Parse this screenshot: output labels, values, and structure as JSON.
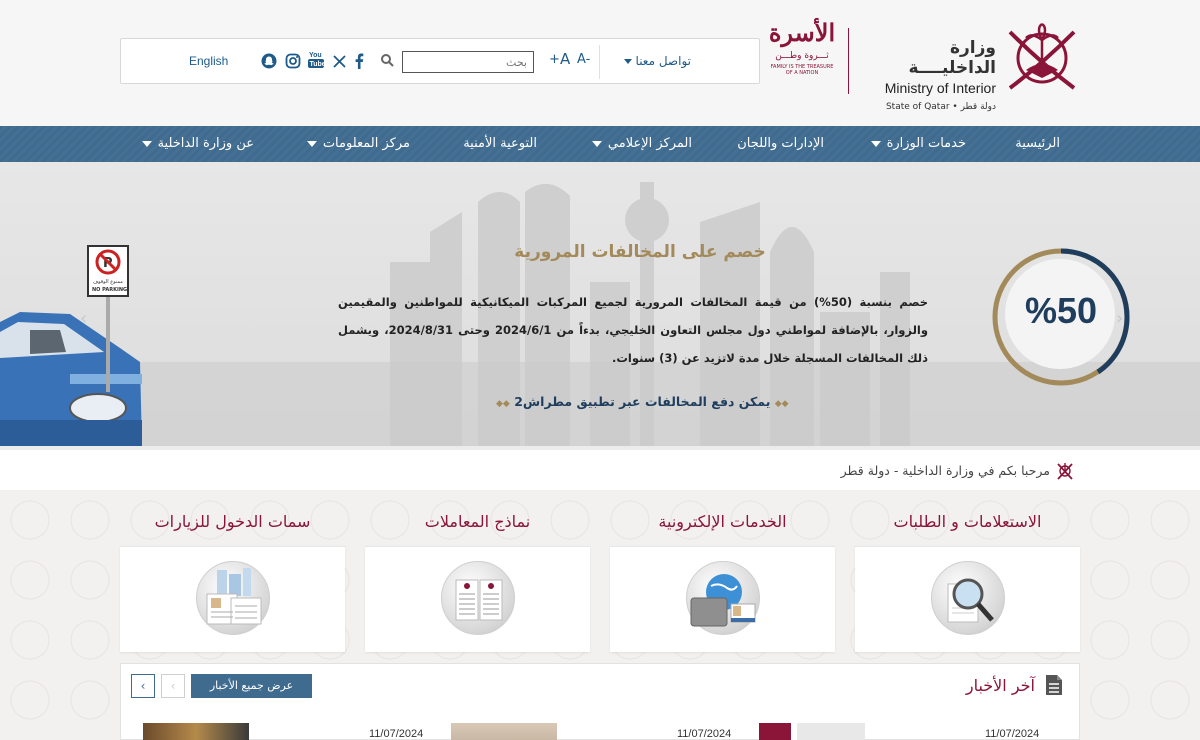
{
  "header": {
    "ministry_ar": "وزارة الداخليــــة",
    "ministry_en": "Ministry of Interior",
    "state": "State of Qatar • دولة قطر",
    "family_logo_ar": "الأسرة",
    "family_logo_sub": "ثـــروة وطـــن",
    "family_logo_tiny": "FAMILY IS THE TREASURE OF A NATION"
  },
  "toolbar": {
    "contact_label": "تواصل معنا",
    "font_decrease": "A-",
    "font_reset": "A",
    "font_increase": "+",
    "search_placeholder": "بحث",
    "english_label": "English",
    "social": [
      "facebook-icon",
      "x-icon",
      "youtube-icon",
      "instagram-icon",
      "snapchat-icon"
    ]
  },
  "nav": {
    "items": [
      {
        "label": "الرئيسية",
        "dropdown": false
      },
      {
        "label": "خدمات الوزارة",
        "dropdown": true
      },
      {
        "label": "الإدارات واللجان",
        "dropdown": false
      },
      {
        "label": "المركز الإعلامي",
        "dropdown": true
      },
      {
        "label": "التوعية الأمنية",
        "dropdown": false
      },
      {
        "label": "مركز المعلومات",
        "dropdown": true
      },
      {
        "label": "عن وزارة الداخلية",
        "dropdown": true
      }
    ]
  },
  "banner": {
    "title": "خصم على المخالفات المرورية",
    "body": "خصم بنسبة (50%) من قيمة المخالفات المرورية لجميع المركبات الميكانيكية للمواطنين والمقيمين والزوار، بالإضافة لمواطني دول مجلس التعاون الخليجي، بدءاً من 2024/6/1 وحتى 2024/8/31، ويشمل ذلك المخالفات المسجلة خلال مدة لاتزيد عن (3) سنوات.",
    "link": "يمكن دفع المخالفات عبر تطبيق مطراش2",
    "percent": "%50",
    "sign_text": "ممنوع الوقوف",
    "sign_text_en": "NO PARKING",
    "colors": {
      "gold": "#a38a5a",
      "navy": "#1f3e5e"
    }
  },
  "welcome": {
    "text": "مرحبا بكم في وزارة الداخلية - دولة قطر"
  },
  "services": [
    {
      "title": "الاستعلامات و الطلبات",
      "icon": "magnifier-document-icon"
    },
    {
      "title": "الخدمات الإلكترونية",
      "icon": "globe-card-icon"
    },
    {
      "title": "نماذج المعاملات",
      "icon": "forms-icon"
    },
    {
      "title": "سمات الدخول للزيارات",
      "icon": "visa-documents-icon"
    }
  ],
  "news": {
    "title": "آخر الأخبار",
    "view_all": "عرض جميع الأخبار",
    "items": [
      {
        "date": "11/07/2024"
      },
      {
        "date": "11/07/2024"
      },
      {
        "date": "11/07/2024"
      }
    ]
  },
  "theme": {
    "maroon": "#8a1538",
    "nav_blue": "#3f6b8f",
    "link_blue": "#1e5a8a"
  }
}
